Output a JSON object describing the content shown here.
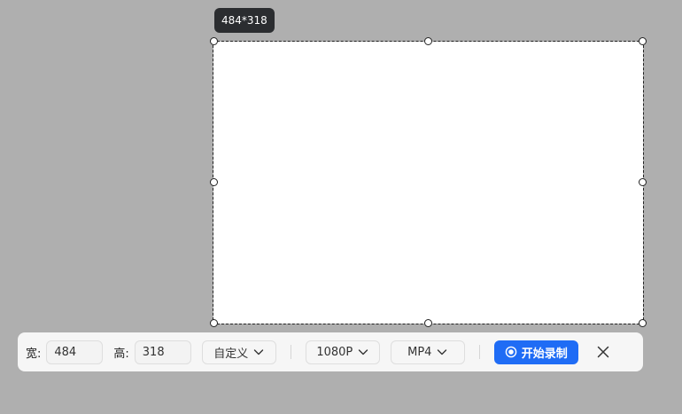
{
  "size_tooltip": "484*318",
  "toolbar": {
    "width_label": "宽:",
    "width_value": "484",
    "height_label": "高:",
    "height_value": "318",
    "preset_select": "自定义",
    "resolution_select": "1080P",
    "format_select": "MP4",
    "record_label": "开始录制"
  },
  "icons": {
    "record": "record-circle-icon",
    "chevron": "chevron-down-icon",
    "close": "close-icon"
  },
  "colors": {
    "backdrop": "#afafaf",
    "accent": "#1f6cf5",
    "tooltip_bg": "#2b2d30"
  }
}
